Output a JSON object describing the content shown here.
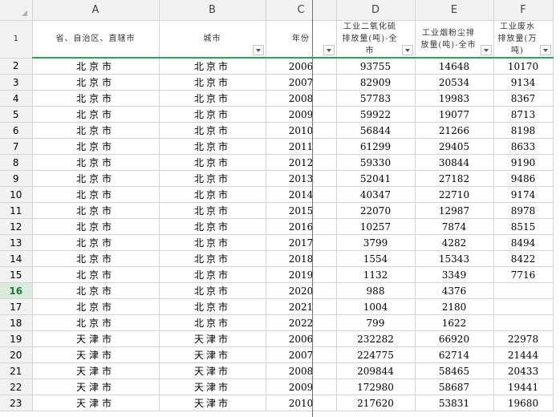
{
  "column_letters": [
    "A",
    "B",
    "C",
    "D",
    "E",
    "F"
  ],
  "field_row_number": "1",
  "fields": [
    {
      "label": "省、自治区、直辖市",
      "filter": false
    },
    {
      "label": "城市",
      "filter": true
    },
    {
      "label": "年份",
      "filter": true
    },
    {
      "label": "工业二氧化硫排放量(吨)-全市",
      "filter": true
    },
    {
      "label": "工业烟粉尘排放量(吨)-全市",
      "filter": true
    },
    {
      "label": "工业废水排放量(万吨)",
      "filter": true
    }
  ],
  "active_row": "16",
  "rows": [
    {
      "n": "2",
      "province": "北京市",
      "city": "北京市",
      "year": "2006",
      "so2": "93755",
      "dust": "14648",
      "water": "10170"
    },
    {
      "n": "3",
      "province": "北京市",
      "city": "北京市",
      "year": "2007",
      "so2": "82909",
      "dust": "20534",
      "water": "9134"
    },
    {
      "n": "4",
      "province": "北京市",
      "city": "北京市",
      "year": "2008",
      "so2": "57783",
      "dust": "19983",
      "water": "8367"
    },
    {
      "n": "5",
      "province": "北京市",
      "city": "北京市",
      "year": "2009",
      "so2": "59922",
      "dust": "19077",
      "water": "8713"
    },
    {
      "n": "6",
      "province": "北京市",
      "city": "北京市",
      "year": "2010",
      "so2": "56844",
      "dust": "21266",
      "water": "8198"
    },
    {
      "n": "7",
      "province": "北京市",
      "city": "北京市",
      "year": "2011",
      "so2": "61299",
      "dust": "29405",
      "water": "8633"
    },
    {
      "n": "8",
      "province": "北京市",
      "city": "北京市",
      "year": "2012",
      "so2": "59330",
      "dust": "30844",
      "water": "9190"
    },
    {
      "n": "9",
      "province": "北京市",
      "city": "北京市",
      "year": "2013",
      "so2": "52041",
      "dust": "27182",
      "water": "9486"
    },
    {
      "n": "10",
      "province": "北京市",
      "city": "北京市",
      "year": "2014",
      "so2": "40347",
      "dust": "22710",
      "water": "9174"
    },
    {
      "n": "11",
      "province": "北京市",
      "city": "北京市",
      "year": "2015",
      "so2": "22070",
      "dust": "12987",
      "water": "8978"
    },
    {
      "n": "12",
      "province": "北京市",
      "city": "北京市",
      "year": "2016",
      "so2": "10257",
      "dust": "7874",
      "water": "8515"
    },
    {
      "n": "13",
      "province": "北京市",
      "city": "北京市",
      "year": "2017",
      "so2": "3799",
      "dust": "4282",
      "water": "8494"
    },
    {
      "n": "14",
      "province": "北京市",
      "city": "北京市",
      "year": "2018",
      "so2": "1554",
      "dust": "15343",
      "water": "8422"
    },
    {
      "n": "15",
      "province": "北京市",
      "city": "北京市",
      "year": "2019",
      "so2": "1132",
      "dust": "3349",
      "water": "7716"
    },
    {
      "n": "16",
      "province": "北京市",
      "city": "北京市",
      "year": "2020",
      "so2": "988",
      "dust": "4376",
      "water": ""
    },
    {
      "n": "17",
      "province": "北京市",
      "city": "北京市",
      "year": "2021",
      "so2": "1004",
      "dust": "2180",
      "water": ""
    },
    {
      "n": "18",
      "province": "北京市",
      "city": "北京市",
      "year": "2022",
      "so2": "799",
      "dust": "1622",
      "water": ""
    },
    {
      "n": "19",
      "province": "天津市",
      "city": "天津市",
      "year": "2006",
      "so2": "232282",
      "dust": "66920",
      "water": "22978"
    },
    {
      "n": "20",
      "province": "天津市",
      "city": "天津市",
      "year": "2007",
      "so2": "224775",
      "dust": "62714",
      "water": "21444"
    },
    {
      "n": "21",
      "province": "天津市",
      "city": "天津市",
      "year": "2008",
      "so2": "209844",
      "dust": "58465",
      "water": "20433"
    },
    {
      "n": "22",
      "province": "天津市",
      "city": "天津市",
      "year": "2009",
      "so2": "172980",
      "dust": "58687",
      "water": "19441"
    },
    {
      "n": "23",
      "province": "天津市",
      "city": "天津市",
      "year": "2010",
      "so2": "217620",
      "dust": "53831",
      "water": "19680"
    }
  ],
  "colors": {
    "header_bg": "#f2f2f2",
    "grid_line": "#d4d4d4",
    "accent_green": "#2e9e5a",
    "active_row_bg": "#d9ecde"
  }
}
